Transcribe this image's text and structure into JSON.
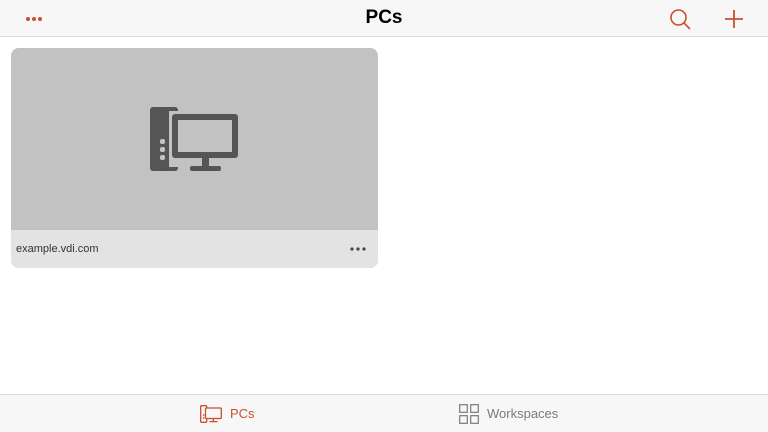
{
  "colors": {
    "accent": "#c8502a",
    "card_thumb": "#c2c2c2",
    "card_footer": "#e3e3e3",
    "icon_gray": "#555555",
    "inactive_tab": "#7a7a7a"
  },
  "header": {
    "title": "PCs",
    "left_icon": "more-horizontal-icon",
    "right_icons": [
      "search-icon",
      "plus-icon"
    ]
  },
  "pcs": [
    {
      "name": "example.vdi.com",
      "icon": "desktop-computer-icon",
      "menu_icon": "more-horizontal-icon"
    }
  ],
  "tabs": [
    {
      "label": "PCs",
      "icon": "pc-tab-icon",
      "active": true
    },
    {
      "label": "Workspaces",
      "icon": "workspaces-grid-icon",
      "active": false
    }
  ]
}
